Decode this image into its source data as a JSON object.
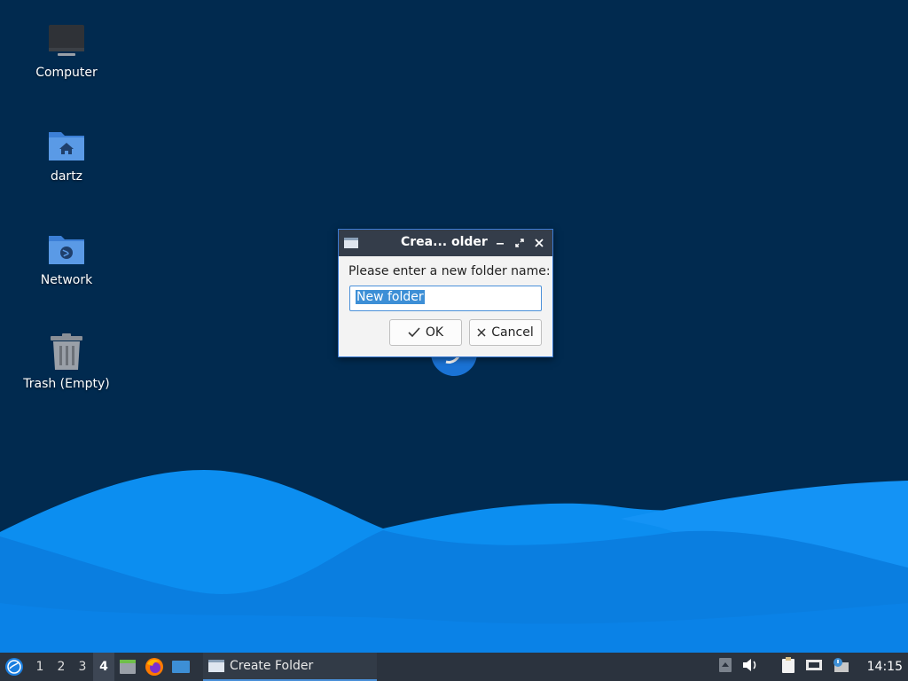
{
  "desktop": {
    "icons": [
      {
        "label": "Computer",
        "icon": "computer-icon"
      },
      {
        "label": "dartz",
        "icon": "home-folder-icon"
      },
      {
        "label": "Network",
        "icon": "network-folder-icon"
      },
      {
        "label": "Trash (Empty)",
        "icon": "trash-icon"
      }
    ]
  },
  "dialog": {
    "title": "Crea... older",
    "prompt": "Please enter a new folder name:",
    "input_value": "New folder",
    "ok_label": "OK",
    "cancel_label": "Cancel",
    "controls": [
      "minimize-icon",
      "maximize-icon",
      "close-icon"
    ]
  },
  "panel": {
    "workspaces": [
      "1",
      "2",
      "3",
      "4"
    ],
    "active_workspace": "4",
    "launchers": [
      "file-manager-icon",
      "firefox-icon",
      "desktop-icon"
    ],
    "task_label": "Create Folder",
    "clock": "14:15",
    "tray_icons": [
      "tray-up-arrow-icon",
      "volume-icon",
      "clipboard-icon",
      "network-wired-icon",
      "update-notifier-icon"
    ]
  },
  "colors": {
    "background": "#012a4f",
    "wave_light": "#0c8ef0",
    "wave_mid": "#0a7ee0",
    "panel": "#2b333e",
    "accent": "#4a90d9"
  }
}
